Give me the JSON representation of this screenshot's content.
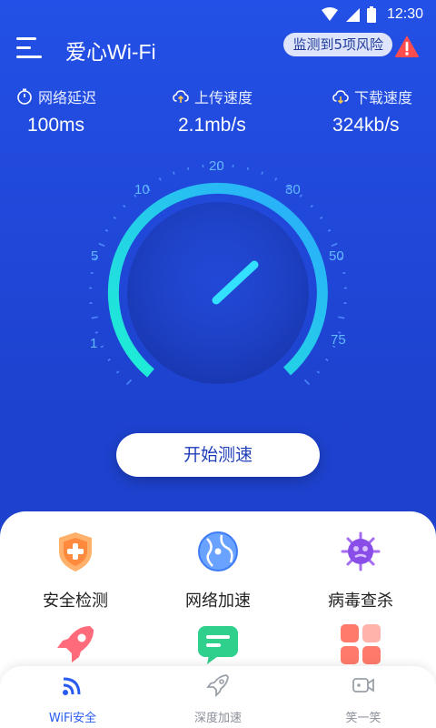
{
  "status_bar": {
    "time": "12:30"
  },
  "header": {
    "title": "爱心Wi-Fi",
    "risk_badge": "监测到5项风险"
  },
  "stats": [
    {
      "label": "网络延迟",
      "value": "100ms",
      "icon": "timer-icon"
    },
    {
      "label": "上传速度",
      "value": "2.1mb/s",
      "icon": "cloud-upload-icon"
    },
    {
      "label": "下载速度",
      "value": "324kb/s",
      "icon": "cloud-download-icon"
    }
  ],
  "gauge": {
    "scale_labels": [
      "1",
      "5",
      "10",
      "20",
      "30",
      "50",
      "75"
    ],
    "colors": {
      "arc_start": "#1ef0d4",
      "arc_end": "#2ba8ff",
      "needle": "#33e0ff"
    }
  },
  "start_button": {
    "label": "开始测速"
  },
  "features": [
    {
      "label": "安全检测",
      "icon": "shield-plus-icon"
    },
    {
      "label": "网络加速",
      "icon": "globe-icon"
    },
    {
      "label": "病毒查杀",
      "icon": "virus-icon"
    },
    {
      "label": "",
      "icon": "rocket-icon"
    },
    {
      "label": "",
      "icon": "message-icon"
    },
    {
      "label": "",
      "icon": "apps-grid-icon"
    }
  ],
  "bottom_nav": [
    {
      "label": "WiFi安全",
      "icon": "wifi-icon",
      "active": true
    },
    {
      "label": "深度加速",
      "icon": "rocket-outline-icon",
      "active": false
    },
    {
      "label": "笑一笑",
      "icon": "video-icon",
      "active": false
    }
  ]
}
